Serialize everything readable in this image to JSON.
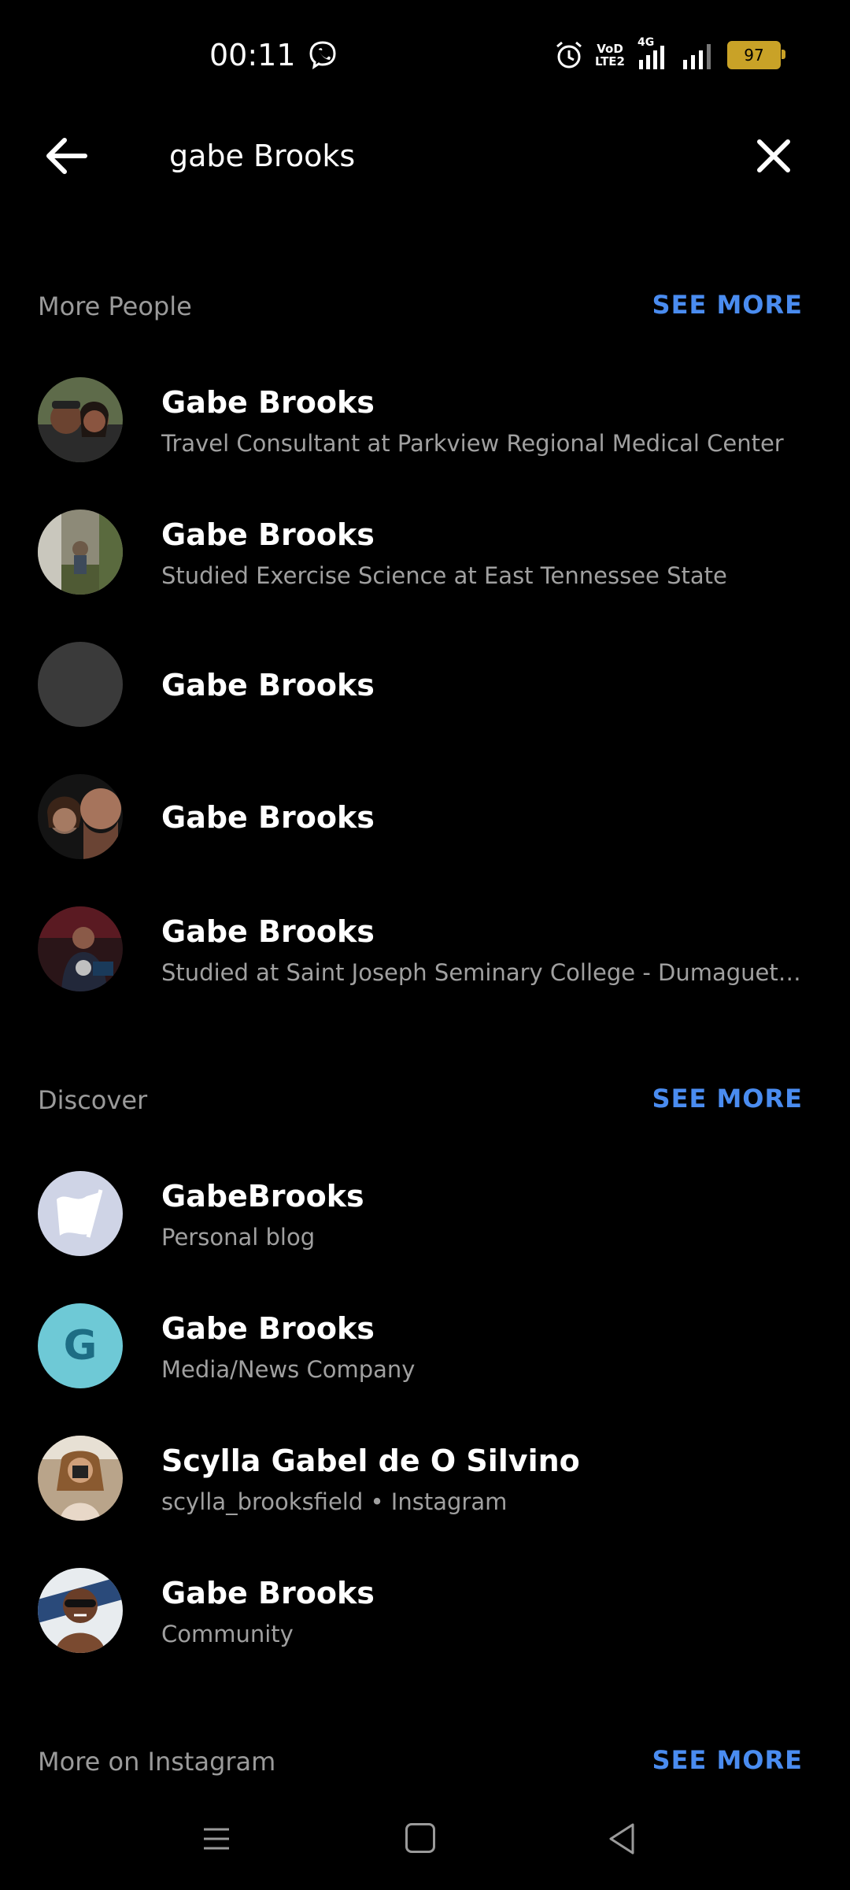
{
  "status_bar": {
    "time": "00:11",
    "battery": "97",
    "volte_line1": "VoD",
    "volte_line2": "LTE2",
    "network": "4G"
  },
  "search": {
    "query": "gabe Brooks"
  },
  "sections": {
    "people": {
      "title": "More People",
      "see_more": "SEE MORE",
      "items": [
        {
          "name": "Gabe Brooks",
          "subtitle": "Travel Consultant at Parkview Regional Medical Center"
        },
        {
          "name": "Gabe Brooks",
          "subtitle": "Studied Exercise Science at East Tennessee State"
        },
        {
          "name": "Gabe Brooks",
          "subtitle": ""
        },
        {
          "name": "Gabe Brooks",
          "subtitle": ""
        },
        {
          "name": "Gabe Brooks",
          "subtitle": "Studied at Saint Joseph Seminary College - Dumaguete Ci..."
        }
      ]
    },
    "discover": {
      "title": "Discover",
      "see_more": "SEE MORE",
      "items": [
        {
          "name": "GabeBrooks",
          "subtitle": "Personal blog"
        },
        {
          "name": "Gabe Brooks",
          "subtitle": "Media/News Company",
          "avatar_letter": "G"
        },
        {
          "name": "Scylla Gabel de O Silvino",
          "subtitle": "scylla_brooksfield • Instagram"
        },
        {
          "name": "Gabe Brooks",
          "subtitle": "Community"
        }
      ]
    },
    "instagram": {
      "title": "More on Instagram",
      "see_more": "SEE MORE"
    }
  },
  "colors": {
    "accent": "#4a8cf0",
    "background": "#000000",
    "secondary_text": "#9a9a9a"
  }
}
